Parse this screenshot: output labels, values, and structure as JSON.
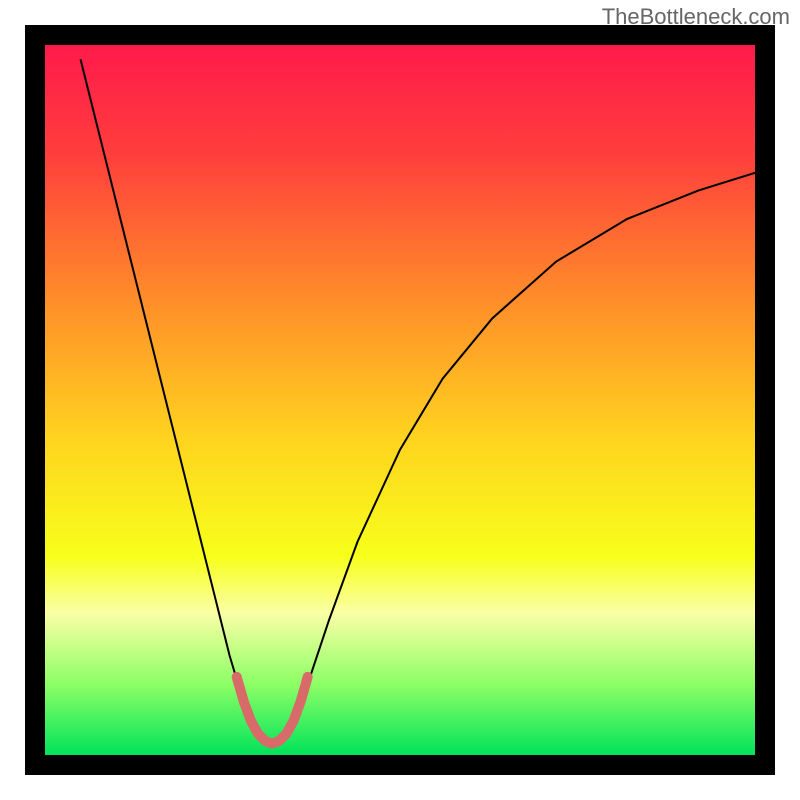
{
  "watermark": "TheBottleneck.com",
  "chart_data": {
    "type": "line",
    "title": "",
    "xlabel": "",
    "ylabel": "",
    "xlim": [
      0,
      100
    ],
    "ylim": [
      0,
      100
    ],
    "grid": false,
    "legend": false,
    "gradient_stops": [
      {
        "offset": 0.0,
        "color": "#ff1a4b"
      },
      {
        "offset": 0.15,
        "color": "#ff3d3d"
      },
      {
        "offset": 0.35,
        "color": "#ff8a2a"
      },
      {
        "offset": 0.55,
        "color": "#ffd21f"
      },
      {
        "offset": 0.72,
        "color": "#f7ff1a"
      },
      {
        "offset": 0.8,
        "color": "#faffa6"
      },
      {
        "offset": 0.9,
        "color": "#8dff66"
      },
      {
        "offset": 1.0,
        "color": "#00e35a"
      }
    ],
    "series": [
      {
        "name": "curve",
        "stroke": "#000000",
        "stroke_width": 2.0,
        "points": [
          {
            "x": 5.0,
            "y": 98.0
          },
          {
            "x": 7.0,
            "y": 90.0
          },
          {
            "x": 10.0,
            "y": 78.0
          },
          {
            "x": 13.0,
            "y": 66.0
          },
          {
            "x": 16.0,
            "y": 54.0
          },
          {
            "x": 19.0,
            "y": 42.0
          },
          {
            "x": 22.0,
            "y": 30.0
          },
          {
            "x": 24.0,
            "y": 22.0
          },
          {
            "x": 26.0,
            "y": 14.0
          },
          {
            "x": 27.5,
            "y": 9.0
          },
          {
            "x": 29.0,
            "y": 4.5
          },
          {
            "x": 30.5,
            "y": 2.0
          },
          {
            "x": 32.0,
            "y": 1.2
          },
          {
            "x": 33.5,
            "y": 2.0
          },
          {
            "x": 35.0,
            "y": 4.5
          },
          {
            "x": 37.0,
            "y": 10.0
          },
          {
            "x": 40.0,
            "y": 19.0
          },
          {
            "x": 44.0,
            "y": 30.0
          },
          {
            "x": 50.0,
            "y": 43.0
          },
          {
            "x": 56.0,
            "y": 53.0
          },
          {
            "x": 63.0,
            "y": 61.5
          },
          {
            "x": 72.0,
            "y": 69.5
          },
          {
            "x": 82.0,
            "y": 75.5
          },
          {
            "x": 92.0,
            "y": 79.5
          },
          {
            "x": 100.0,
            "y": 82.0
          }
        ]
      },
      {
        "name": "highlight",
        "stroke": "#d86a6a",
        "stroke_width": 10.0,
        "points": [
          {
            "x": 27.0,
            "y": 11.0
          },
          {
            "x": 28.0,
            "y": 7.5
          },
          {
            "x": 29.0,
            "y": 4.8
          },
          {
            "x": 30.0,
            "y": 3.0
          },
          {
            "x": 31.0,
            "y": 2.0
          },
          {
            "x": 32.0,
            "y": 1.6
          },
          {
            "x": 33.0,
            "y": 2.0
          },
          {
            "x": 34.0,
            "y": 3.0
          },
          {
            "x": 35.0,
            "y": 4.8
          },
          {
            "x": 36.0,
            "y": 7.5
          },
          {
            "x": 37.0,
            "y": 11.0
          }
        ]
      }
    ]
  }
}
